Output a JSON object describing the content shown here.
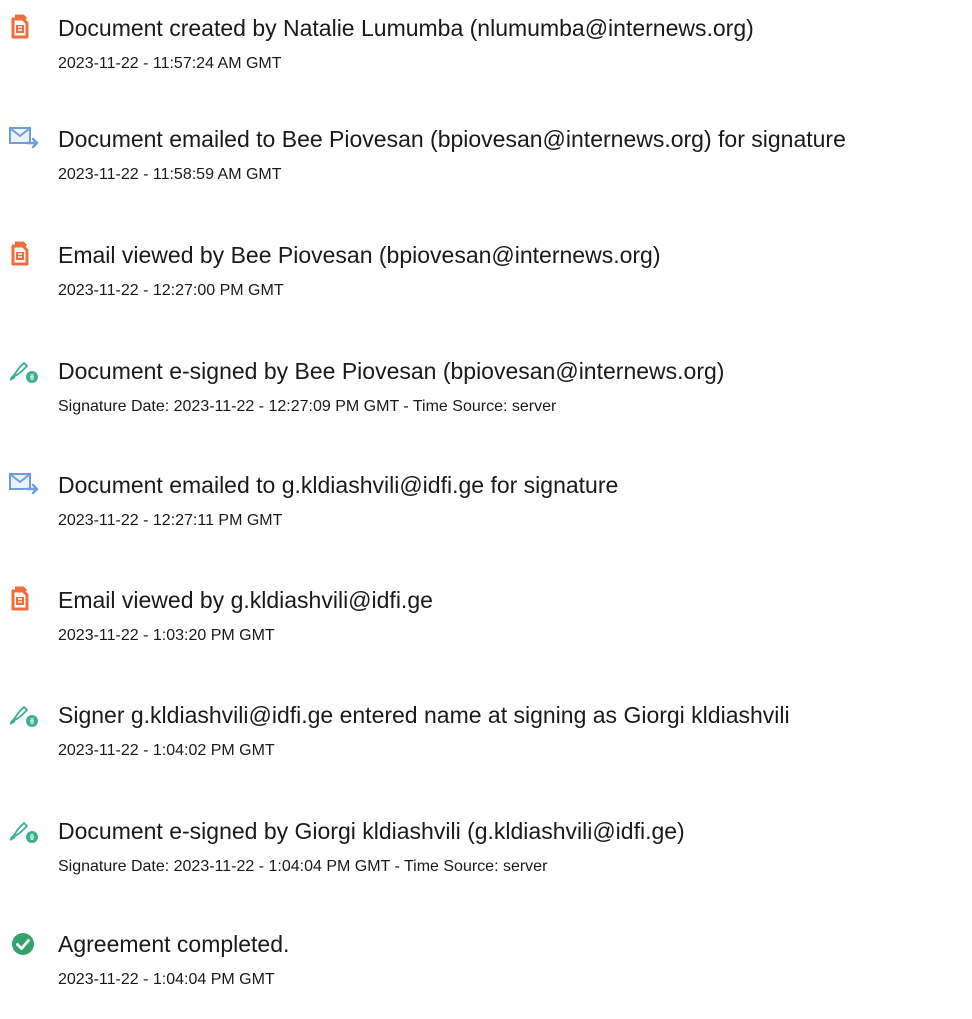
{
  "events": [
    {
      "icon": "document-created-icon",
      "title": "Document created by Natalie Lumumba (nlumumba@internews.org)",
      "meta": "2023-11-22 - 11:57:24 AM GMT"
    },
    {
      "icon": "email-sent-icon",
      "title": "Document emailed to Bee Piovesan (bpiovesan@internews.org) for signature",
      "meta": "2023-11-22 - 11:58:59 AM GMT"
    },
    {
      "icon": "email-viewed-icon",
      "title": "Email viewed by Bee Piovesan (bpiovesan@internews.org)",
      "meta": "2023-11-22 - 12:27:00 PM GMT"
    },
    {
      "icon": "e-sign-icon",
      "title": "Document e-signed by Bee Piovesan (bpiovesan@internews.org)",
      "meta": "Signature Date: 2023-11-22 - 12:27:09 PM GMT - Time Source: server"
    },
    {
      "icon": "email-sent-icon",
      "title": "Document emailed to g.kldiashvili@idfi.ge for signature",
      "meta": "2023-11-22 - 12:27:11 PM GMT"
    },
    {
      "icon": "email-viewed-icon",
      "title": "Email viewed by g.kldiashvili@idfi.ge",
      "meta": "2023-11-22 - 1:03:20 PM GMT"
    },
    {
      "icon": "signer-name-icon",
      "title": "Signer g.kldiashvili@idfi.ge entered name at signing as Giorgi kldiashvili",
      "meta": "2023-11-22 - 1:04:02 PM GMT"
    },
    {
      "icon": "e-sign-icon",
      "title": "Document e-signed by Giorgi kldiashvili (g.kldiashvili@idfi.ge)",
      "meta": "Signature Date: 2023-11-22 - 1:04:04 PM GMT - Time Source: server"
    },
    {
      "icon": "completed-check-icon",
      "title": "Agreement completed.",
      "meta": "2023-11-22 - 1:04:04 PM GMT"
    }
  ],
  "colors": {
    "document_icon": "#f26c3b",
    "email_icon": "#6f9fd8",
    "sign_icon": "#3bb08e",
    "complete_icon": "#34a36b",
    "text": "#1a1a1a"
  }
}
